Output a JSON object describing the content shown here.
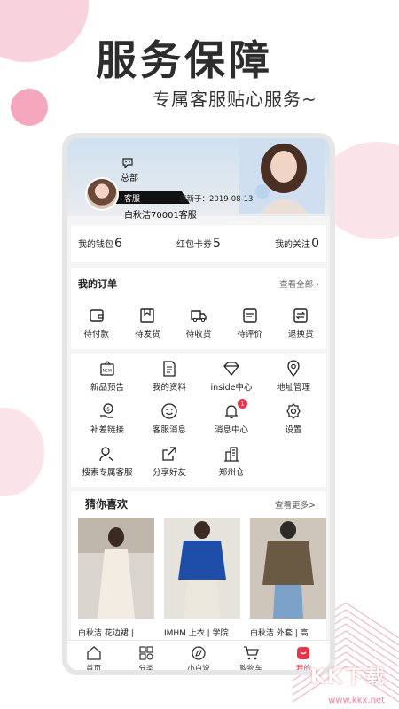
{
  "hero": {
    "title": "服务保障",
    "subtitle": "专属客服贴心服务~"
  },
  "watermark": {
    "text": "KK下载",
    "url": "www.kkx.net"
  },
  "profile": {
    "hq_label": "总部",
    "service_label": "客服",
    "update_text": "更新于：2019-08-13",
    "shop_name": "白秋洁70001客服"
  },
  "stats": [
    {
      "label": "我的钱包",
      "value": "6"
    },
    {
      "label": "红包卡券",
      "value": "5"
    },
    {
      "label": "我的关注",
      "value": "0"
    }
  ],
  "orders": {
    "title": "我的订单",
    "see_all": "查看全部",
    "items": [
      {
        "label": "待付款",
        "icon": "wallet-icon"
      },
      {
        "label": "待发货",
        "icon": "package-icon"
      },
      {
        "label": "待收货",
        "icon": "truck-icon"
      },
      {
        "label": "待评价",
        "icon": "review-icon"
      },
      {
        "label": "退换货",
        "icon": "exchange-icon"
      }
    ]
  },
  "menu": [
    {
      "label": "新品预告",
      "icon": "new-icon"
    },
    {
      "label": "我的资料",
      "icon": "profile-doc-icon"
    },
    {
      "label": "inside中心",
      "icon": "diamond-icon"
    },
    {
      "label": "地址管理",
      "icon": "location-icon"
    },
    {
      "label": "补差链接",
      "icon": "money-link-icon"
    },
    {
      "label": "客服消息",
      "icon": "smile-icon"
    },
    {
      "label": "消息中心",
      "icon": "bell-icon",
      "badge": "1"
    },
    {
      "label": "设置",
      "icon": "gear-icon"
    },
    {
      "label": "搜索专属客服",
      "icon": "search-user-icon"
    },
    {
      "label": "分享好友",
      "icon": "share-icon"
    },
    {
      "label": "郑州仓",
      "icon": "building-icon"
    }
  ],
  "guess": {
    "title": "猜你喜欢",
    "more": "查看更多>",
    "products": [
      {
        "title": "白秋洁 花边裙 |"
      },
      {
        "title": "IMHM 上衣 | 学院"
      },
      {
        "title": "白秋洁 外套 | 高"
      }
    ]
  },
  "tabbar": [
    {
      "label": "首页",
      "icon": "home-icon"
    },
    {
      "label": "分类",
      "icon": "category-icon"
    },
    {
      "label": "小白说",
      "icon": "compass-icon"
    },
    {
      "label": "购物车",
      "icon": "cart-icon"
    },
    {
      "label": "我的",
      "icon": "me-icon",
      "active": true
    }
  ],
  "colors": {
    "accent": "#e8344b",
    "pink": "#f4a7bd",
    "banner": "#cfe1ef"
  }
}
